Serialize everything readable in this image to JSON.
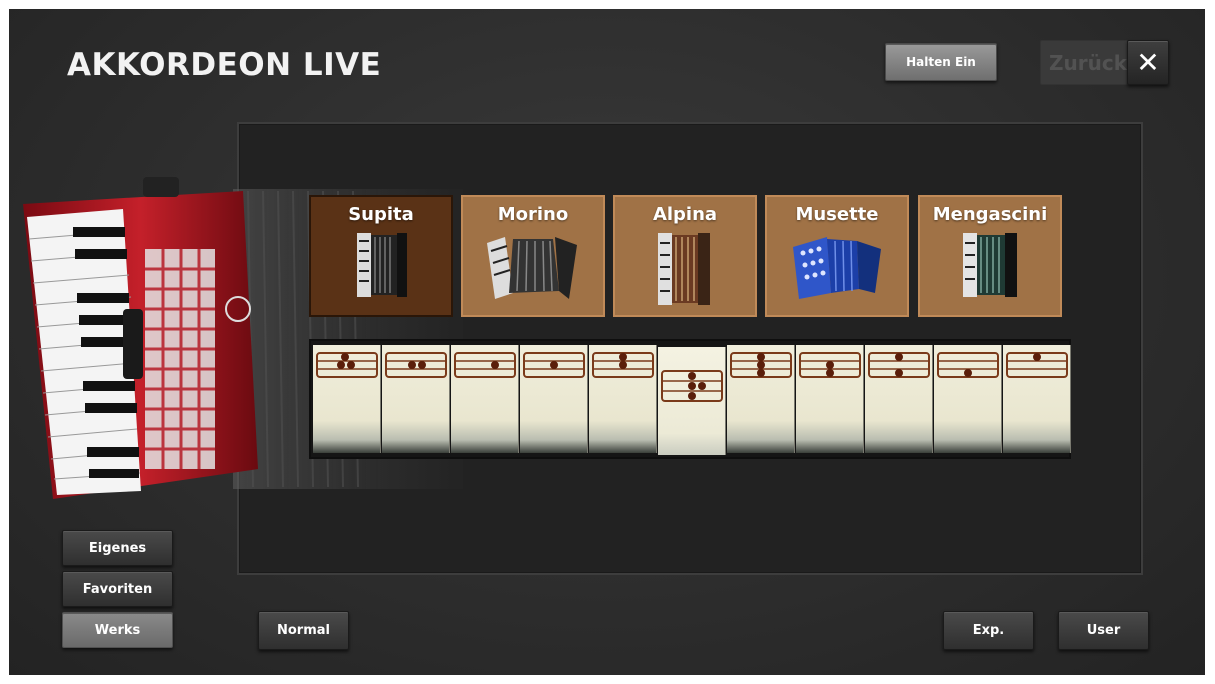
{
  "header": {
    "title": "AKKORDEON LIVE"
  },
  "top_buttons": {
    "halten_label": "Halten Ein",
    "zurueck_label": "Zurück",
    "close_label": "✕"
  },
  "voices": [
    {
      "name": "Supita",
      "selected": true
    },
    {
      "name": "Morino",
      "selected": false
    },
    {
      "name": "Alpina",
      "selected": false
    },
    {
      "name": "Musette",
      "selected": false
    },
    {
      "name": "Mengascini",
      "selected": false
    }
  ],
  "registers": {
    "count": 11,
    "selected_index": 5
  },
  "side_buttons": {
    "eigenes_label": "Eigenes",
    "favoriten_label": "Favoriten",
    "werks_label": "Werks",
    "active": "Werks"
  },
  "bottom_buttons": {
    "normal_label": "Normal",
    "exp_label": "Exp.",
    "user_label": "User"
  },
  "colors": {
    "voice_tile": "#a07246",
    "voice_tile_selected": "#5a3216",
    "accordion_red": "#b3121d",
    "background": "#2c2c2c"
  }
}
